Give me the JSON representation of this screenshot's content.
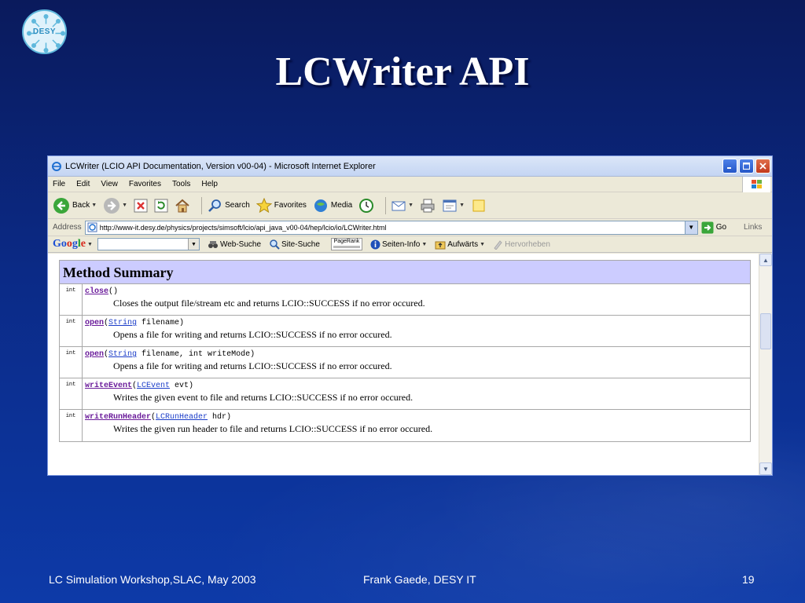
{
  "slide": {
    "logo_text": "DESY",
    "title": "LCWriter API",
    "footer_left": "LC Simulation Workshop,SLAC, May  2003",
    "footer_center": "Frank Gaede, DESY IT",
    "footer_right": "19"
  },
  "window": {
    "title": "LCWriter (LCIO API Documentation, Version v00-04) - Microsoft Internet Explorer"
  },
  "menu": [
    "File",
    "Edit",
    "View",
    "Favorites",
    "Tools",
    "Help"
  ],
  "toolbar": {
    "back": "Back",
    "search": "Search",
    "favorites": "Favorites",
    "media": "Media"
  },
  "address": {
    "label": "Address",
    "url": "http://www-it.desy.de/physics/projects/simsoft/lcio/api_java_v00-04/hep/lcio/io/LCWriter.html",
    "go": "Go",
    "links": "Links"
  },
  "googlebar": {
    "logo": [
      "Go",
      "o",
      "g",
      "l",
      "e"
    ],
    "web_search": "Web-Suche",
    "site_search": "Site-Suche",
    "pagerank": "PageRank",
    "page_info": "Seiten-Info",
    "up": "Aufwärts",
    "highlight": "Hervorheben"
  },
  "summary": {
    "heading": "Method Summary",
    "rows": [
      {
        "type": "int",
        "method": "close",
        "pre": "",
        "param_type": "",
        "post": "()",
        "desc": "Closes the output file/stream etc and returns LCIO::SUCCESS if no error occured."
      },
      {
        "type": "int",
        "method": "open",
        "pre": "(",
        "param_type": "String",
        "post": " filename)",
        "desc": "Opens a file for writing and returns LCIO::SUCCESS if no error occured."
      },
      {
        "type": "int",
        "method": "open",
        "pre": "(",
        "param_type": "String",
        "post": " filename, int writeMode)",
        "desc": "Opens a file for writing and returns LCIO::SUCCESS if no error occured."
      },
      {
        "type": "int",
        "method": "writeEvent",
        "pre": "(",
        "param_type": "LCEvent",
        "post": " evt)",
        "desc": "Writes the given event to file and returns LCIO::SUCCESS if no error occured."
      },
      {
        "type": "int",
        "method": "writeRunHeader",
        "pre": "(",
        "param_type": "LCRunHeader",
        "post": " hdr)",
        "desc": "Writes the given run header to file and returns LCIO::SUCCESS if no error occured."
      }
    ]
  },
  "colors": {
    "slide_bg": "#0b2a86",
    "summary_header_bg": "#ccccff",
    "method_link": "#6a1b9a",
    "type_link": "#1a3cc8"
  },
  "icons": [
    "desy-logo",
    "ie-icon",
    "minimize-icon",
    "maximize-icon",
    "close-icon",
    "windows-flag-icon",
    "back-icon",
    "forward-icon",
    "stop-icon",
    "refresh-icon",
    "home-icon",
    "search-icon",
    "favorites-icon",
    "media-icon",
    "history-icon",
    "mail-icon",
    "print-icon",
    "edit-icon",
    "messenger-icon",
    "page-icon",
    "go-icon",
    "binoculars-icon",
    "info-icon",
    "folder-up-icon",
    "highlighter-icon",
    "scroll-up-icon",
    "scroll-down-icon"
  ]
}
